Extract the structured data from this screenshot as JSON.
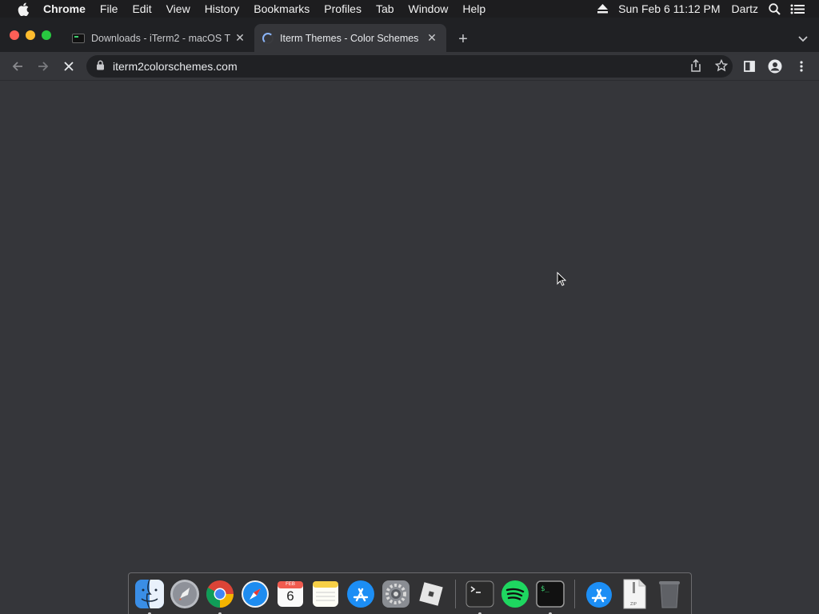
{
  "menubar": {
    "app_name": "Chrome",
    "items": [
      "File",
      "Edit",
      "View",
      "History",
      "Bookmarks",
      "Profiles",
      "Tab",
      "Window",
      "Help"
    ],
    "datetime": "Sun Feb 6  11:12 PM",
    "user": "Dartz"
  },
  "tabs": [
    {
      "title": "Downloads - iTerm2 - macOS T",
      "active": false
    },
    {
      "title": "Iterm Themes - Color Schemes",
      "active": true,
      "loading": true
    }
  ],
  "toolbar": {
    "url": "iterm2colorschemes.com"
  },
  "dock": {
    "calendar_month": "FEB",
    "calendar_day": "6",
    "apps": [
      "finder",
      "launchpad",
      "chrome",
      "safari",
      "calendar",
      "notes",
      "app-store",
      "system-preferences",
      "roblox",
      "terminal",
      "spotify",
      "iterm2",
      "app-store-downloads",
      "zip-archive",
      "trash"
    ]
  },
  "colors": {
    "menubar_bg": "#1d1d1f",
    "tabstrip_bg": "#202124",
    "toolbar_bg": "#35363a",
    "content_bg": "#35363a",
    "accent": "#8ab4f8"
  }
}
